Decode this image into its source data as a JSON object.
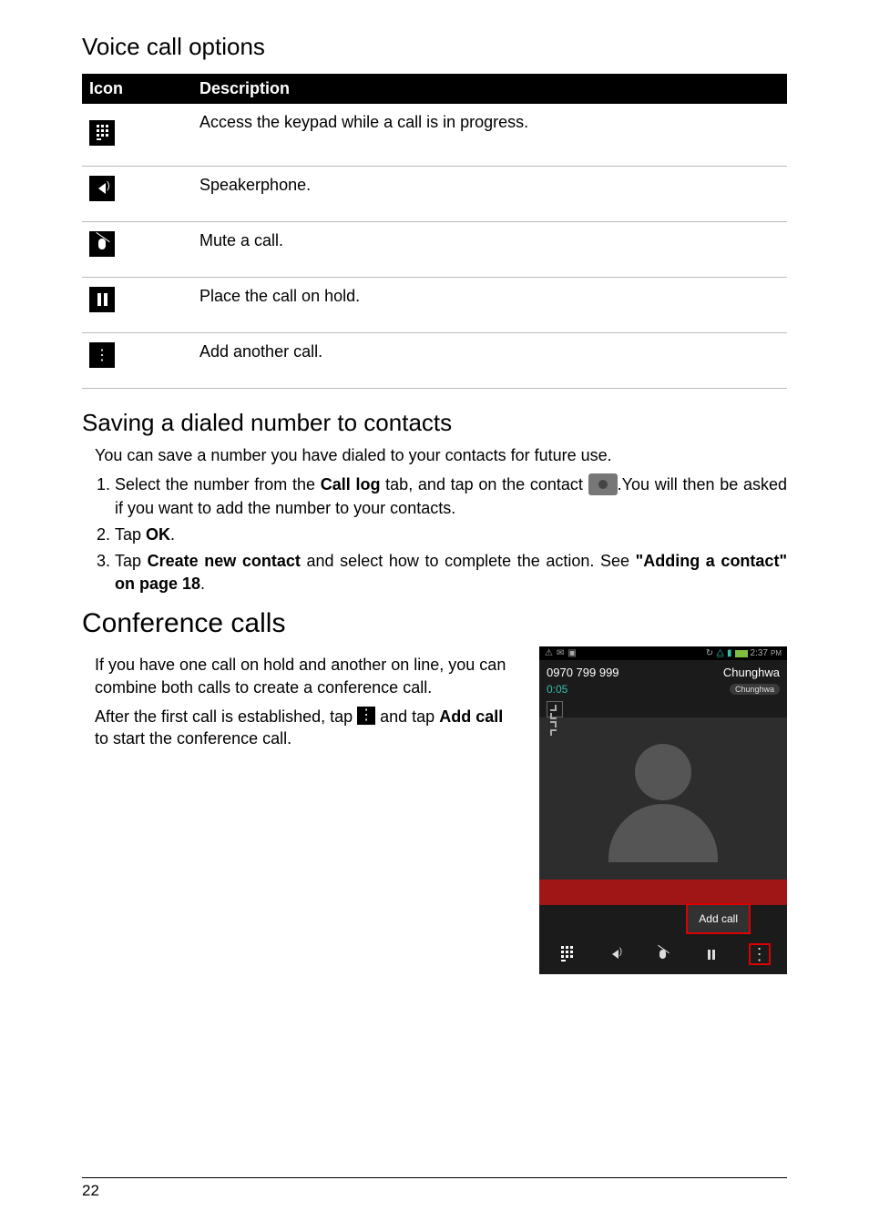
{
  "headings": {
    "voice_options": "Voice call options",
    "saving": "Saving a dialed number to contacts",
    "conference": "Conference calls"
  },
  "table": {
    "headers": {
      "icon": "Icon",
      "desc": "Description"
    },
    "rows": [
      {
        "icon_name": "keypad-icon",
        "desc": "Access the keypad while a call is in progress."
      },
      {
        "icon_name": "speaker-icon",
        "desc": "Speakerphone."
      },
      {
        "icon_name": "mute-icon",
        "desc": "Mute a call."
      },
      {
        "icon_name": "hold-icon",
        "desc": "Place the call on hold."
      },
      {
        "icon_name": "add-call-icon",
        "desc": "Add another call."
      }
    ]
  },
  "saving": {
    "intro": "You can save a number you have dialed to your contacts for future use.",
    "steps": {
      "s1a": "Select the number from the ",
      "s1_b_bold": "Call log",
      "s1c": " tab, and tap on the contact ",
      "s1d": ".You will then be asked if you want to add the number to your contacts.",
      "s2a": "Tap ",
      "s2_b_bold": "OK",
      "s2c": ".",
      "s3a": "Tap ",
      "s3_b_bold": "Create new contact",
      "s3c": " and select how to complete the action. See ",
      "s3_d_bold": "\"Adding a contact\" on page 18",
      "s3e": "."
    }
  },
  "conference": {
    "p1": "If you have one call on hold and another on line, you can combine both calls to create a conference call.",
    "p2a": "After the first call is established, tap ",
    "p2b": " and tap ",
    "p2_bold": "Add call",
    "p2c": " to start the conference call."
  },
  "phone": {
    "status_time": "2:37",
    "status_ampm": "PM",
    "number": "0970 799 999",
    "operator": "Chunghwa",
    "timer": "0:05",
    "operator_badge": "Chunghwa",
    "popup": "Add call"
  },
  "page_number": "22"
}
